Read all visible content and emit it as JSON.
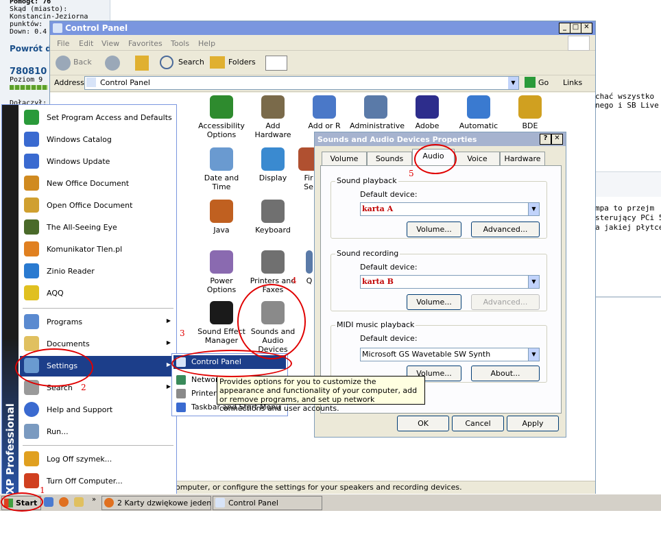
{
  "forum": {
    "lines": [
      "Pomogł: 76",
      "Skąd (miasto):",
      "Konstancin-Jeziorna",
      "punktów:",
      "Down: 0.4"
    ],
    "back_link": "Powrót d",
    "user_id": "780810",
    "level": "Poziom 9",
    "joined": "Dołączył:",
    "right_lines": [
      "chać wszystko",
      "nego i SB Live !",
      "mpa to przejm",
      "sterujący PCi 5",
      "a jakiej płytce?"
    ]
  },
  "control_panel": {
    "title": "Control Panel",
    "menu": [
      "File",
      "Edit",
      "View",
      "Favorites",
      "Tools",
      "Help"
    ],
    "toolbar": {
      "back": "Back",
      "search": "Search",
      "folders": "Folders"
    },
    "address_label": "Address",
    "address_value": "Control Panel",
    "go_label": "Go",
    "links_label": "Links",
    "icons": [
      {
        "label": "Accessibility Options",
        "color": "#2e8b2e"
      },
      {
        "label": "Add Hardware",
        "color": "#7a6a4a"
      },
      {
        "label": "Add or R",
        "color": "#4a78c8"
      },
      {
        "label": "Administrative Tools",
        "color": "#5a7aa8"
      },
      {
        "label": "Adobe Gamma",
        "color": "#2d2d8c"
      },
      {
        "label": "Automatic Updates",
        "color": "#3a7ad0"
      },
      {
        "label": "BDE Administrator",
        "color": "#d0a020"
      },
      {
        "label": "Date and Time",
        "color": "#6a9ad0"
      },
      {
        "label": "Display",
        "color": "#3a8ad0"
      },
      {
        "label": "Fir Se",
        "color": "#b05030"
      },
      {
        "label": "Java",
        "color": "#c06020"
      },
      {
        "label": "Keyboard",
        "color": "#707070"
      },
      {
        "label": "Power Options",
        "color": "#8a6ab0"
      },
      {
        "label": "Printers and Faxes",
        "color": "#707070"
      },
      {
        "label": "Q",
        "color": "#5a7aa8"
      },
      {
        "label": "Sound Effect Manager",
        "color": "#1a1a1a"
      },
      {
        "label": "Sounds and Audio Devices",
        "color": "#8a8a8a"
      }
    ],
    "status": "omputer, or configure the settings for your speakers and recording devices."
  },
  "start_menu": {
    "stripe": "Windows XP Professional",
    "items": [
      {
        "label": "Set Program Access and Defaults",
        "icon": "program-access-icon",
        "color": "#2a9a3a"
      },
      {
        "label": "Windows Catalog",
        "icon": "windows-catalog-icon",
        "color": "#3a6ad0"
      },
      {
        "label": "Windows Update",
        "icon": "windows-update-icon",
        "color": "#3a6ad0"
      },
      {
        "label": "New Office Document",
        "icon": "new-office-document-icon",
        "color": "#d08a20"
      },
      {
        "label": "Open Office Document",
        "icon": "open-office-document-icon",
        "color": "#d0a030"
      },
      {
        "label": "The All-Seeing Eye",
        "icon": "all-seeing-eye-icon",
        "color": "#4a6a2a"
      },
      {
        "label": "Komunikator Tlen.pl",
        "icon": "tlen-icon",
        "color": "#e08020"
      },
      {
        "label": "Zinio Reader",
        "icon": "zinio-icon",
        "color": "#2a7ad0"
      },
      {
        "label": "AQQ",
        "icon": "aqq-icon",
        "color": "#e0c020"
      }
    ],
    "programs": "Programs",
    "documents": "Documents",
    "settings": "Settings",
    "search": "Search",
    "help": "Help and Support",
    "run": "Run...",
    "logoff": "Log Off szymek...",
    "turnoff": "Turn Off Computer..."
  },
  "settings_submenu": {
    "items": [
      "Control Panel",
      "Network Connections",
      "Printers and Faxes",
      "Taskbar and Start Menu"
    ]
  },
  "tooltip": "Provides options for you to customize the appearance and functionality of your computer, add or remove programs, and set up network connections and user accounts.",
  "sound_dialog": {
    "title": "Sounds and Audio Devices Properties",
    "tabs": [
      "Volume",
      "Sounds",
      "Audio",
      "Voice",
      "Hardware"
    ],
    "playback": {
      "group": "Sound playback",
      "label": "Default device:",
      "value": "karta A",
      "volume": "Volume...",
      "advanced": "Advanced..."
    },
    "recording": {
      "group": "Sound recording",
      "label": "Default device:",
      "value": "karta B",
      "volume": "Volume...",
      "advanced": "Advanced..."
    },
    "midi": {
      "group": "MIDI music playback",
      "label": "Default device:",
      "value": "Microsoft GS Wavetable SW Synth",
      "volume": "Volume...",
      "about": "About..."
    },
    "ok": "OK",
    "cancel": "Cancel",
    "apply": "Apply"
  },
  "taskbar": {
    "start": "Start",
    "tasks": [
      "2 Karty dzwiękowe jeden...",
      "Control Panel"
    ]
  },
  "annotations": [
    "1",
    "2",
    "3",
    "4",
    "5"
  ]
}
